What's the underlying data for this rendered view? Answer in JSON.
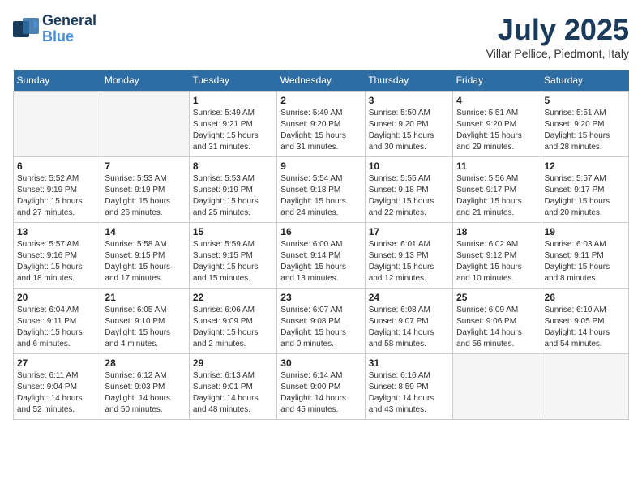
{
  "logo": {
    "line1": "General",
    "line2": "Blue"
  },
  "title": "July 2025",
  "location": "Villar Pellice, Piedmont, Italy",
  "days_of_week": [
    "Sunday",
    "Monday",
    "Tuesday",
    "Wednesday",
    "Thursday",
    "Friday",
    "Saturday"
  ],
  "weeks": [
    [
      {
        "num": "",
        "info": ""
      },
      {
        "num": "",
        "info": ""
      },
      {
        "num": "1",
        "info": "Sunrise: 5:49 AM\nSunset: 9:21 PM\nDaylight: 15 hours\nand 31 minutes."
      },
      {
        "num": "2",
        "info": "Sunrise: 5:49 AM\nSunset: 9:20 PM\nDaylight: 15 hours\nand 31 minutes."
      },
      {
        "num": "3",
        "info": "Sunrise: 5:50 AM\nSunset: 9:20 PM\nDaylight: 15 hours\nand 30 minutes."
      },
      {
        "num": "4",
        "info": "Sunrise: 5:51 AM\nSunset: 9:20 PM\nDaylight: 15 hours\nand 29 minutes."
      },
      {
        "num": "5",
        "info": "Sunrise: 5:51 AM\nSunset: 9:20 PM\nDaylight: 15 hours\nand 28 minutes."
      }
    ],
    [
      {
        "num": "6",
        "info": "Sunrise: 5:52 AM\nSunset: 9:19 PM\nDaylight: 15 hours\nand 27 minutes."
      },
      {
        "num": "7",
        "info": "Sunrise: 5:53 AM\nSunset: 9:19 PM\nDaylight: 15 hours\nand 26 minutes."
      },
      {
        "num": "8",
        "info": "Sunrise: 5:53 AM\nSunset: 9:19 PM\nDaylight: 15 hours\nand 25 minutes."
      },
      {
        "num": "9",
        "info": "Sunrise: 5:54 AM\nSunset: 9:18 PM\nDaylight: 15 hours\nand 24 minutes."
      },
      {
        "num": "10",
        "info": "Sunrise: 5:55 AM\nSunset: 9:18 PM\nDaylight: 15 hours\nand 22 minutes."
      },
      {
        "num": "11",
        "info": "Sunrise: 5:56 AM\nSunset: 9:17 PM\nDaylight: 15 hours\nand 21 minutes."
      },
      {
        "num": "12",
        "info": "Sunrise: 5:57 AM\nSunset: 9:17 PM\nDaylight: 15 hours\nand 20 minutes."
      }
    ],
    [
      {
        "num": "13",
        "info": "Sunrise: 5:57 AM\nSunset: 9:16 PM\nDaylight: 15 hours\nand 18 minutes."
      },
      {
        "num": "14",
        "info": "Sunrise: 5:58 AM\nSunset: 9:15 PM\nDaylight: 15 hours\nand 17 minutes."
      },
      {
        "num": "15",
        "info": "Sunrise: 5:59 AM\nSunset: 9:15 PM\nDaylight: 15 hours\nand 15 minutes."
      },
      {
        "num": "16",
        "info": "Sunrise: 6:00 AM\nSunset: 9:14 PM\nDaylight: 15 hours\nand 13 minutes."
      },
      {
        "num": "17",
        "info": "Sunrise: 6:01 AM\nSunset: 9:13 PM\nDaylight: 15 hours\nand 12 minutes."
      },
      {
        "num": "18",
        "info": "Sunrise: 6:02 AM\nSunset: 9:12 PM\nDaylight: 15 hours\nand 10 minutes."
      },
      {
        "num": "19",
        "info": "Sunrise: 6:03 AM\nSunset: 9:11 PM\nDaylight: 15 hours\nand 8 minutes."
      }
    ],
    [
      {
        "num": "20",
        "info": "Sunrise: 6:04 AM\nSunset: 9:11 PM\nDaylight: 15 hours\nand 6 minutes."
      },
      {
        "num": "21",
        "info": "Sunrise: 6:05 AM\nSunset: 9:10 PM\nDaylight: 15 hours\nand 4 minutes."
      },
      {
        "num": "22",
        "info": "Sunrise: 6:06 AM\nSunset: 9:09 PM\nDaylight: 15 hours\nand 2 minutes."
      },
      {
        "num": "23",
        "info": "Sunrise: 6:07 AM\nSunset: 9:08 PM\nDaylight: 15 hours\nand 0 minutes."
      },
      {
        "num": "24",
        "info": "Sunrise: 6:08 AM\nSunset: 9:07 PM\nDaylight: 14 hours\nand 58 minutes."
      },
      {
        "num": "25",
        "info": "Sunrise: 6:09 AM\nSunset: 9:06 PM\nDaylight: 14 hours\nand 56 minutes."
      },
      {
        "num": "26",
        "info": "Sunrise: 6:10 AM\nSunset: 9:05 PM\nDaylight: 14 hours\nand 54 minutes."
      }
    ],
    [
      {
        "num": "27",
        "info": "Sunrise: 6:11 AM\nSunset: 9:04 PM\nDaylight: 14 hours\nand 52 minutes."
      },
      {
        "num": "28",
        "info": "Sunrise: 6:12 AM\nSunset: 9:03 PM\nDaylight: 14 hours\nand 50 minutes."
      },
      {
        "num": "29",
        "info": "Sunrise: 6:13 AM\nSunset: 9:01 PM\nDaylight: 14 hours\nand 48 minutes."
      },
      {
        "num": "30",
        "info": "Sunrise: 6:14 AM\nSunset: 9:00 PM\nDaylight: 14 hours\nand 45 minutes."
      },
      {
        "num": "31",
        "info": "Sunrise: 6:16 AM\nSunset: 8:59 PM\nDaylight: 14 hours\nand 43 minutes."
      },
      {
        "num": "",
        "info": ""
      },
      {
        "num": "",
        "info": ""
      }
    ]
  ]
}
